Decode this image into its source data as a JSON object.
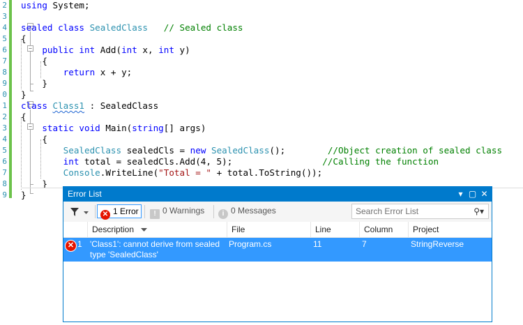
{
  "editor": {
    "line_numbers": [
      "2",
      "3",
      "4",
      "5",
      "6",
      "7",
      "8",
      "9",
      "0",
      "1",
      "2",
      "3",
      "4",
      "5",
      "6",
      "7",
      "8",
      "9"
    ],
    "code": {
      "l2_kw": "using",
      "l2_rest": " System;",
      "l4_kw": "sealed class",
      "l4_type": "SealedClass",
      "l4_comment": "// Sealed class",
      "l5": "{",
      "l6_kw": "public int",
      "l6_a": " Add(",
      "l6_kw2": "int",
      "l6_b": " x, ",
      "l6_kw3": "int",
      "l6_c": " y)",
      "l7": "{",
      "l8_kw": "return",
      "l8_rest": " x + y;",
      "l9": "}",
      "l10": "}",
      "l11_kw": "class",
      "l11_name": "Class1",
      "l11_rest": " : SealedClass",
      "l12": "{",
      "l13_kw": "static void",
      "l13_a": " Main(",
      "l13_kw2": "string",
      "l13_b": "[] args)",
      "l14": "{",
      "l15_type": "SealedClass",
      "l15_a": " sealedCls = ",
      "l15_kw": "new",
      "l15_type2": "SealedClass",
      "l15_b": "();",
      "l15_comment": "//Object creation of sealed class",
      "l16_kw": "int",
      "l16_a": " total = sealedCls.Add(4, 5);",
      "l16_comment": "//Calling the function",
      "l17_type": "Console",
      "l17_a": ".WriteLine(",
      "l17_str": "\"Total = \"",
      "l17_b": " + total.ToString());",
      "l18": "}",
      "l19": "}"
    }
  },
  "error_list": {
    "title": "Error List",
    "title_buttons": {
      "dropdown": "▾",
      "maximize": "▢",
      "close": "✕"
    },
    "toolbar": {
      "filter_icon": "filter-icon",
      "errors_count": "1 Error",
      "warnings_count": "0 Warnings",
      "messages_count": "0 Messages",
      "search_placeholder": "Search Error List"
    },
    "columns": [
      "Description",
      "File",
      "Line",
      "Column",
      "Project"
    ],
    "rows": [
      {
        "index": "1",
        "description_line1": "'Class1': cannot derive from sealed",
        "description_line2": "type 'SealedClass'",
        "file": "Program.cs",
        "line": "11",
        "column": "7",
        "project": "StringReverse"
      }
    ]
  },
  "colors": {
    "accent": "#007acc",
    "selection": "#3399ff",
    "error": "#e51400",
    "keyword": "#0000ff",
    "type": "#2b91af",
    "comment": "#008000",
    "string": "#a31515",
    "change_bar": "#6cc24a"
  }
}
